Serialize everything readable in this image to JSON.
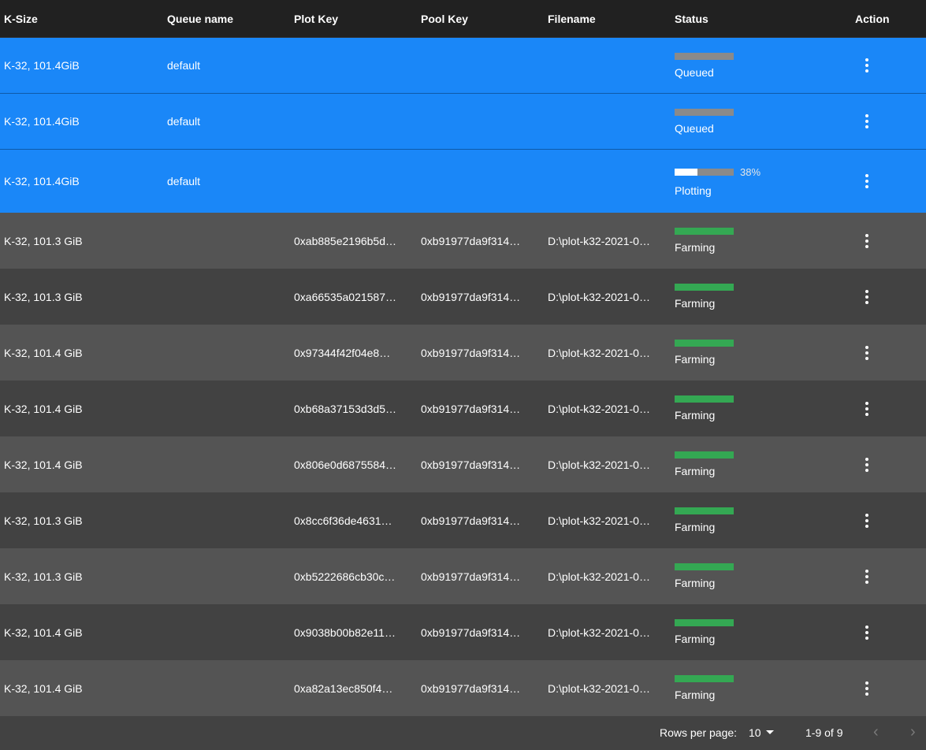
{
  "header": {
    "ksize": "K-Size",
    "queue": "Queue name",
    "plot_key": "Plot Key",
    "pool_key": "Pool Key",
    "filename": "Filename",
    "status": "Status",
    "action": "Action"
  },
  "queued_rows": [
    {
      "ksize": "K-32, 101.4GiB",
      "queue": "default",
      "status": "Queued",
      "progress": null,
      "percent": ""
    },
    {
      "ksize": "K-32, 101.4GiB",
      "queue": "default",
      "status": "Queued",
      "progress": null,
      "percent": ""
    },
    {
      "ksize": "K-32, 101.4GiB",
      "queue": "default",
      "status": "Plotting",
      "progress": 0.38,
      "percent": "38%"
    }
  ],
  "farm_rows": [
    {
      "ksize": "K-32, 101.3 GiB",
      "plot_key": "0xab885e2196b5d…",
      "pool_key": "0xb91977da9f314…",
      "filename": "D:\\plot-k32-2021-0…",
      "status": "Farming"
    },
    {
      "ksize": "K-32, 101.3 GiB",
      "plot_key": "0xa66535a021587…",
      "pool_key": "0xb91977da9f314…",
      "filename": "D:\\plot-k32-2021-0…",
      "status": "Farming"
    },
    {
      "ksize": "K-32, 101.4 GiB",
      "plot_key": "0x97344f42f04e8…",
      "pool_key": "0xb91977da9f314…",
      "filename": "D:\\plot-k32-2021-0…",
      "status": "Farming"
    },
    {
      "ksize": "K-32, 101.4 GiB",
      "plot_key": "0xb68a37153d3d5…",
      "pool_key": "0xb91977da9f314…",
      "filename": "D:\\plot-k32-2021-0…",
      "status": "Farming"
    },
    {
      "ksize": "K-32, 101.4 GiB",
      "plot_key": "0x806e0d6875584…",
      "pool_key": "0xb91977da9f314…",
      "filename": "D:\\plot-k32-2021-0…",
      "status": "Farming"
    },
    {
      "ksize": "K-32, 101.3 GiB",
      "plot_key": "0x8cc6f36de4631…",
      "pool_key": "0xb91977da9f314…",
      "filename": "D:\\plot-k32-2021-0…",
      "status": "Farming"
    },
    {
      "ksize": "K-32, 101.3 GiB",
      "plot_key": "0xb5222686cb30c…",
      "pool_key": "0xb91977da9f314…",
      "filename": "D:\\plot-k32-2021-0…",
      "status": "Farming"
    },
    {
      "ksize": "K-32, 101.4 GiB",
      "plot_key": "0x9038b00b82e11…",
      "pool_key": "0xb91977da9f314…",
      "filename": "D:\\plot-k32-2021-0…",
      "status": "Farming"
    },
    {
      "ksize": "K-32, 101.4 GiB",
      "plot_key": "0xa82a13ec850f4…",
      "pool_key": "0xb91977da9f314…",
      "filename": "D:\\plot-k32-2021-0…",
      "status": "Farming"
    }
  ],
  "footer": {
    "rows_per_page_label": "Rows per page:",
    "rows_per_page_value": "10",
    "range": "1-9 of 9",
    "prev_icon": "chevron-left-icon",
    "next_icon": "chevron-right-icon"
  },
  "colors": {
    "selected_row": "#1a87f8",
    "header_bg": "#212121",
    "farming_bar": "#34a853",
    "queued_bar": "#8a8a8a"
  }
}
